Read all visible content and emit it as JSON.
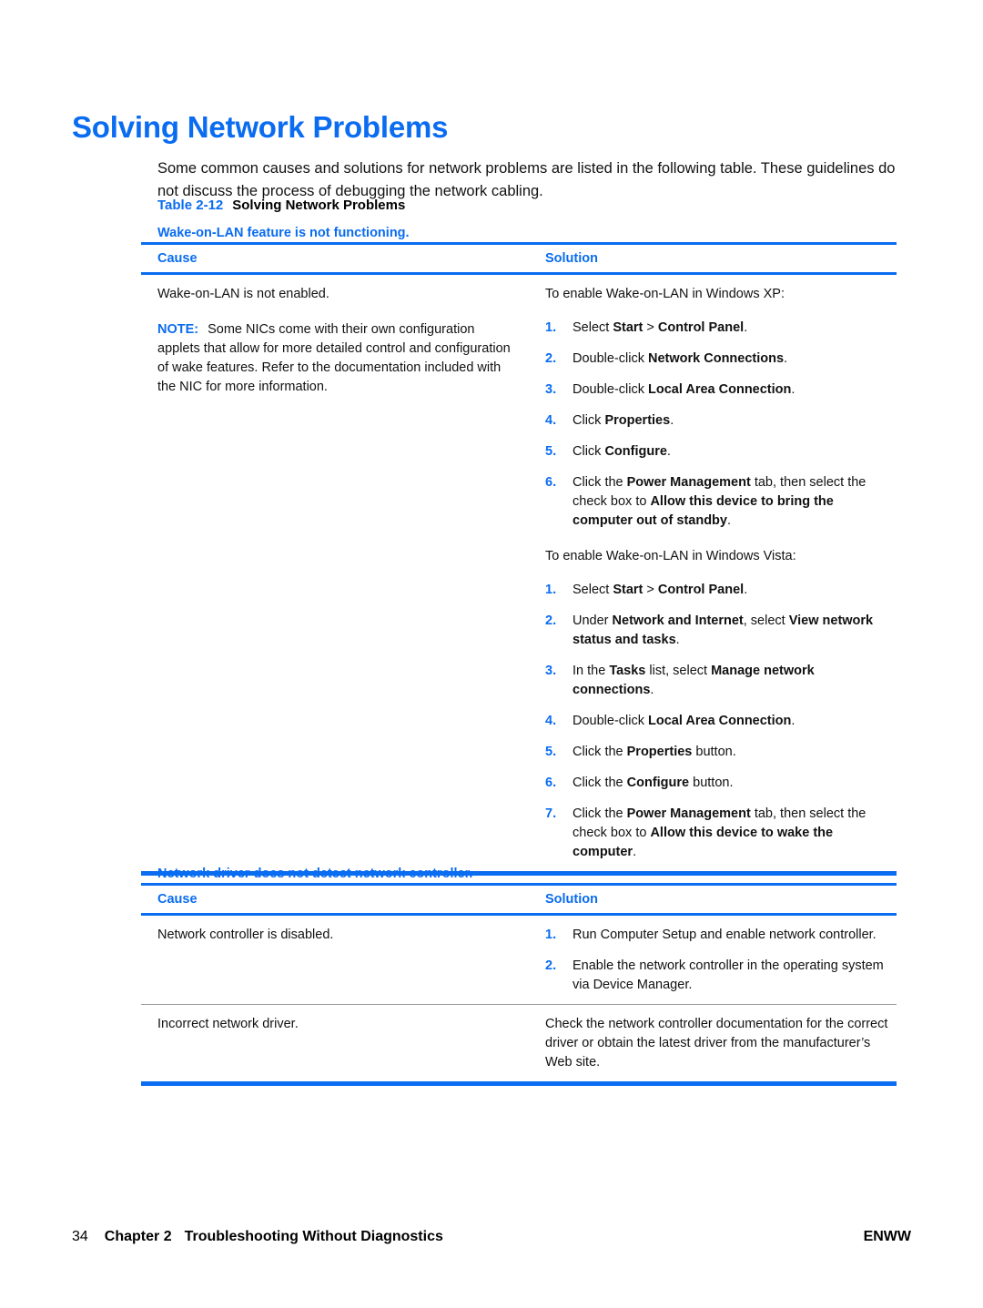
{
  "heading": "Solving Network Problems",
  "intro": "Some common causes and solutions for network problems are listed in the following table. These guidelines do not discuss the process of debugging the network cabling.",
  "caption": {
    "number": "Table 2-12",
    "text": "Solving Network Problems"
  },
  "columns": {
    "cause": "Cause",
    "solution": "Solution"
  },
  "section1": {
    "title": "Wake-on-LAN feature is not functioning.",
    "cause": {
      "text": "Wake-on-LAN is not enabled.",
      "note_label": "NOTE:",
      "note_text": "Some NICs come with their own configuration applets that allow for more detailed control and configuration of wake features. Refer to the documentation included with the NIC for more information."
    },
    "solution": {
      "xp_lead": "To enable Wake-on-LAN in Windows XP:",
      "xp_steps": [
        {
          "num": "1.",
          "parts": [
            {
              "t": "Select ",
              "b": false
            },
            {
              "t": "Start",
              "b": true
            },
            {
              "t": " > ",
              "b": false
            },
            {
              "t": "Control Panel",
              "b": true
            },
            {
              "t": ".",
              "b": false
            }
          ]
        },
        {
          "num": "2.",
          "parts": [
            {
              "t": "Double-click ",
              "b": false
            },
            {
              "t": "Network Connections",
              "b": true
            },
            {
              "t": ".",
              "b": false
            }
          ]
        },
        {
          "num": "3.",
          "parts": [
            {
              "t": "Double-click ",
              "b": false
            },
            {
              "t": "Local Area Connection",
              "b": true
            },
            {
              "t": ".",
              "b": false
            }
          ]
        },
        {
          "num": "4.",
          "parts": [
            {
              "t": "Click ",
              "b": false
            },
            {
              "t": "Properties",
              "b": true
            },
            {
              "t": ".",
              "b": false
            }
          ]
        },
        {
          "num": "5.",
          "parts": [
            {
              "t": "Click ",
              "b": false
            },
            {
              "t": "Configure",
              "b": true
            },
            {
              "t": ".",
              "b": false
            }
          ]
        },
        {
          "num": "6.",
          "parts": [
            {
              "t": "Click the ",
              "b": false
            },
            {
              "t": "Power Management",
              "b": true
            },
            {
              "t": " tab, then select the check box to ",
              "b": false
            },
            {
              "t": "Allow this device to bring the computer out of standby",
              "b": true
            },
            {
              "t": ".",
              "b": false
            }
          ]
        }
      ],
      "vista_lead": "To enable Wake-on-LAN in Windows Vista:",
      "vista_steps": [
        {
          "num": "1.",
          "parts": [
            {
              "t": "Select ",
              "b": false
            },
            {
              "t": "Start",
              "b": true
            },
            {
              "t": " > ",
              "b": false
            },
            {
              "t": "Control Panel",
              "b": true
            },
            {
              "t": ".",
              "b": false
            }
          ]
        },
        {
          "num": "2.",
          "parts": [
            {
              "t": "Under ",
              "b": false
            },
            {
              "t": "Network and Internet",
              "b": true
            },
            {
              "t": ", select ",
              "b": false
            },
            {
              "t": "View network status and tasks",
              "b": true
            },
            {
              "t": ".",
              "b": false
            }
          ]
        },
        {
          "num": "3.",
          "parts": [
            {
              "t": "In the ",
              "b": false
            },
            {
              "t": "Tasks",
              "b": true
            },
            {
              "t": " list, select ",
              "b": false
            },
            {
              "t": "Manage network connections",
              "b": true
            },
            {
              "t": ".",
              "b": false
            }
          ]
        },
        {
          "num": "4.",
          "parts": [
            {
              "t": "Double-click ",
              "b": false
            },
            {
              "t": "Local Area Connection",
              "b": true
            },
            {
              "t": ".",
              "b": false
            }
          ]
        },
        {
          "num": "5.",
          "parts": [
            {
              "t": "Click the ",
              "b": false
            },
            {
              "t": "Properties",
              "b": true
            },
            {
              "t": " button.",
              "b": false
            }
          ]
        },
        {
          "num": "6.",
          "parts": [
            {
              "t": "Click the ",
              "b": false
            },
            {
              "t": "Configure",
              "b": true
            },
            {
              "t": " button.",
              "b": false
            }
          ]
        },
        {
          "num": "7.",
          "parts": [
            {
              "t": "Click the ",
              "b": false
            },
            {
              "t": "Power Management",
              "b": true
            },
            {
              "t": " tab, then select the check box to ",
              "b": false
            },
            {
              "t": "Allow this device to wake the computer",
              "b": true
            },
            {
              "t": ".",
              "b": false
            }
          ]
        }
      ]
    }
  },
  "section2": {
    "title": "Network driver does not detect network controller.",
    "rows": [
      {
        "cause": "Network controller is disabled.",
        "steps": [
          {
            "num": "1.",
            "parts": [
              {
                "t": "Run Computer Setup and enable network controller.",
                "b": false
              }
            ]
          },
          {
            "num": "2.",
            "parts": [
              {
                "t": "Enable the network controller in the operating system via Device Manager.",
                "b": false
              }
            ]
          }
        ]
      },
      {
        "cause": "Incorrect network driver.",
        "text": "Check the network controller documentation for the correct driver or obtain the latest driver from the manufacturer’s Web site."
      }
    ]
  },
  "footer": {
    "page_number": "34",
    "chapter": "Chapter 2",
    "chapter_title": "Troubleshooting Without Diagnostics",
    "right": "ENWW"
  },
  "colors": {
    "accent_blue": "#0a6cf0",
    "body_text": "#111111",
    "row_divider": "#9a9a9a"
  }
}
